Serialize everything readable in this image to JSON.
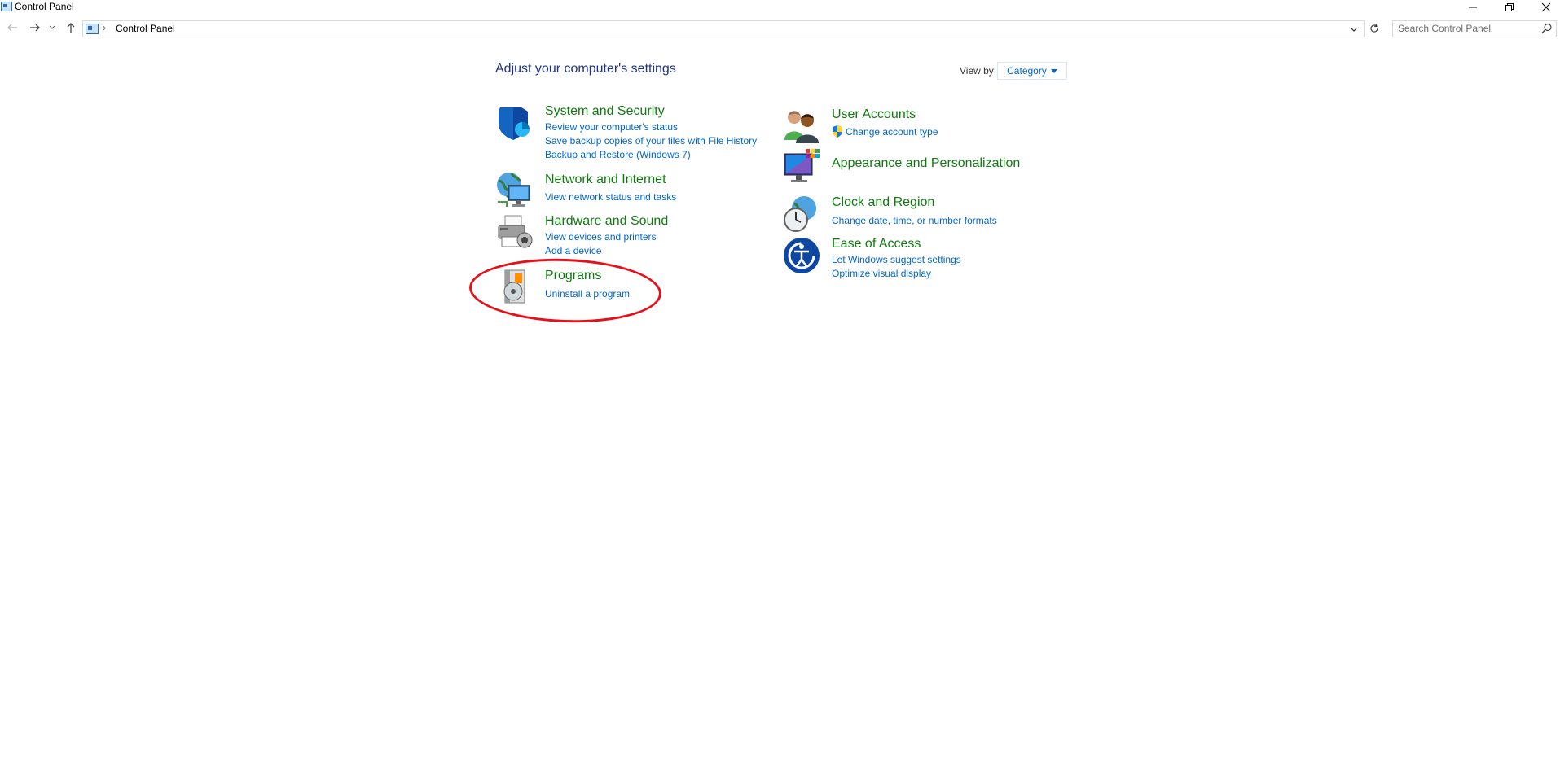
{
  "window": {
    "title": "Control Panel"
  },
  "address": {
    "breadcrumb": "Control Panel",
    "search_placeholder": "Search Control Panel"
  },
  "content": {
    "heading": "Adjust your computer's settings",
    "view_by_label": "View by:",
    "view_by_value": "Category"
  },
  "categories": {
    "system_security": {
      "title": "System and Security",
      "links": [
        "Review your computer's status",
        "Save backup copies of your files with File History",
        "Backup and Restore (Windows 7)"
      ]
    },
    "network_internet": {
      "title": "Network and Internet",
      "links": [
        "View network status and tasks"
      ]
    },
    "hardware_sound": {
      "title": "Hardware and Sound",
      "links": [
        "View devices and printers",
        "Add a device"
      ]
    },
    "programs": {
      "title": "Programs",
      "links": [
        "Uninstall a program"
      ]
    },
    "user_accounts": {
      "title": "User Accounts",
      "links": [
        "Change account type"
      ]
    },
    "appearance": {
      "title": "Appearance and Personalization"
    },
    "clock_region": {
      "title": "Clock and Region",
      "links": [
        "Change date, time, or number formats"
      ]
    },
    "ease_access": {
      "title": "Ease of Access",
      "links": [
        "Let Windows suggest settings",
        "Optimize visual display"
      ]
    }
  },
  "colors": {
    "category_title": "#0f7b0f",
    "link": "#0066cc",
    "heading": "#1e3287",
    "annotation": "#e5101a"
  },
  "icons": {
    "system_security": "shield-icon",
    "network_internet": "globe-monitor-icon",
    "hardware_sound": "printer-icon",
    "programs": "programs-disc-icon",
    "user_accounts": "users-icon",
    "appearance": "monitor-palette-icon",
    "clock_region": "globe-clock-icon",
    "ease_access": "ease-of-access-icon"
  }
}
